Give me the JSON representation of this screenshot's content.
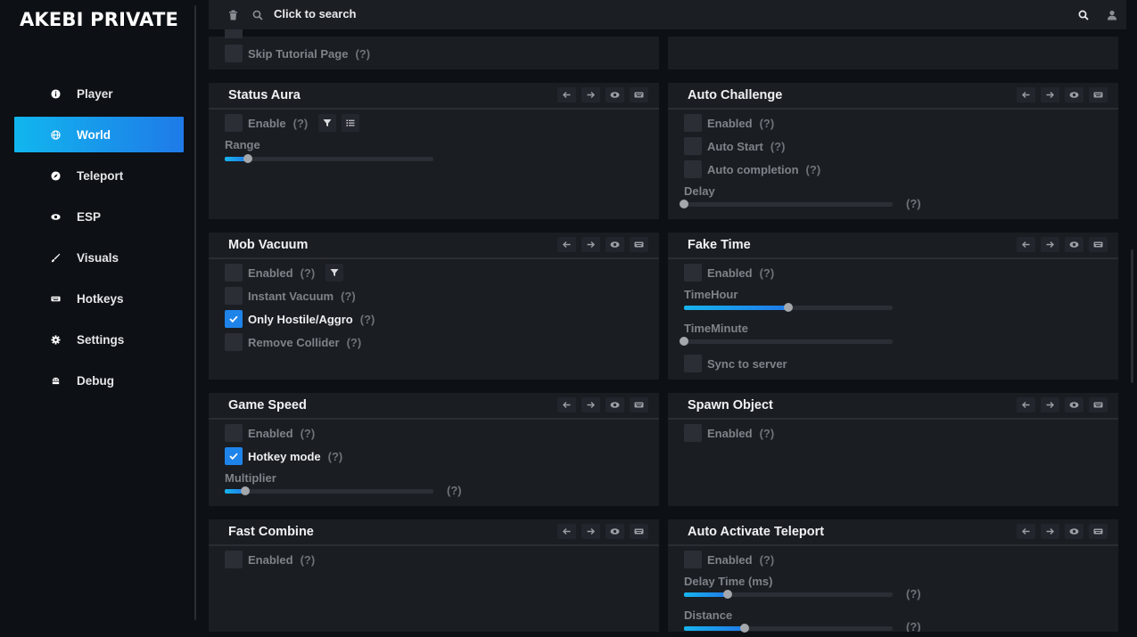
{
  "brand": "AKEBI PRIVATE",
  "nav": [
    {
      "label": "Player",
      "icon": "info-circle-icon"
    },
    {
      "label": "World",
      "icon": "globe-icon",
      "active": true
    },
    {
      "label": "Teleport",
      "icon": "compass-icon"
    },
    {
      "label": "ESP",
      "icon": "eye-icon"
    },
    {
      "label": "Visuals",
      "icon": "brush-icon"
    },
    {
      "label": "Hotkeys",
      "icon": "keyboard-icon"
    },
    {
      "label": "Settings",
      "icon": "gear-icon"
    },
    {
      "label": "Debug",
      "icon": "bug-icon"
    }
  ],
  "search": {
    "placeholder": "Click to search"
  },
  "q": "(?)",
  "colors": {
    "accent": "#1e84ea",
    "accent_gradient_start": "#11b6ee",
    "panel_bg": "#1a1d22",
    "app_bg": "#0d1014"
  },
  "panels": {
    "top_left": {
      "item": "Skip Tutorial Page"
    },
    "status_aura": {
      "title": "Status Aura",
      "enable": "Enable",
      "range_label": "Range",
      "range_fraction": 0.11
    },
    "auto_challenge": {
      "title": "Auto Challenge",
      "enabled": "Enabled",
      "auto_start": "Auto Start",
      "auto_completion": "Auto completion",
      "delay_label": "Delay",
      "delay_fraction": 0.0
    },
    "mob_vacuum": {
      "title": "Mob Vacuum",
      "enabled": "Enabled",
      "instant_vacuum": "Instant Vacuum",
      "only_hostile": "Only Hostile/Aggro",
      "remove_collider": "Remove Collider",
      "only_hostile_checked": true
    },
    "fake_time": {
      "title": "Fake Time",
      "enabled": "Enabled",
      "time_hour_label": "TimeHour",
      "time_hour_fraction": 0.5,
      "time_minute_label": "TimeMinute",
      "time_minute_fraction": 0.0,
      "sync": "Sync to server"
    },
    "game_speed": {
      "title": "Game Speed",
      "enabled": "Enabled",
      "hotkey_mode": "Hotkey mode",
      "hotkey_mode_checked": true,
      "multiplier_label": "Multiplier",
      "multiplier_fraction": 0.1
    },
    "spawn_object": {
      "title": "Spawn Object",
      "enabled": "Enabled"
    },
    "fast_combine": {
      "title": "Fast Combine",
      "enabled": "Enabled"
    },
    "auto_teleport": {
      "title": "Auto Activate Teleport",
      "enabled": "Enabled",
      "delay_label": "Delay Time (ms)",
      "delay_fraction": 0.21,
      "distance_label": "Distance",
      "distance_fraction": 0.29
    }
  }
}
